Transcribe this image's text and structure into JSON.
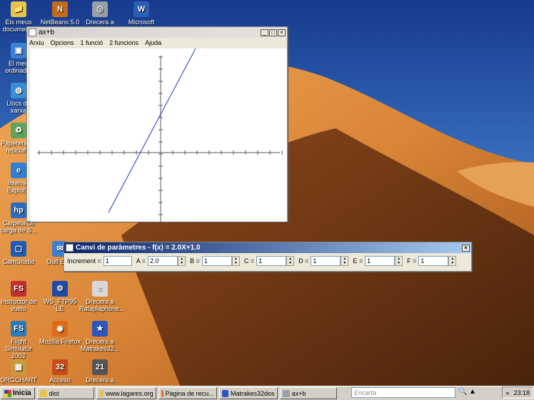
{
  "desktop_icons": [
    {
      "label": "Els meus documen...",
      "color": "#e7c44a",
      "glyph": "📁"
    },
    {
      "label": "NetBeans 5.0",
      "color": "#c46b1a",
      "glyph": "N"
    },
    {
      "label": "Drecera a",
      "color": "#9aa0aa",
      "glyph": "◎"
    },
    {
      "label": "Microsoft Word",
      "color": "#2b5fb5",
      "glyph": "W"
    },
    {
      "label": "El meu ordinad...",
      "color": "#3b7fd6",
      "glyph": "▣"
    },
    {
      "label": "Llocs de xarxa",
      "color": "#3a8ed4",
      "glyph": "◍"
    },
    {
      "label": "Paperera de reciclat...",
      "color": "#5ea35e",
      "glyph": "♻"
    },
    {
      "label": "Internet Explor...",
      "color": "#2f7fd2",
      "glyph": "e"
    },
    {
      "label": "Carpeta de carga de S...",
      "color": "#2b6bc0",
      "glyph": "hp"
    },
    {
      "label": "CamStudio",
      "color": "#1d5cb8",
      "glyph": "▢"
    },
    {
      "label": "Outl Expr",
      "color": "#3a7fd0",
      "glyph": "✉"
    },
    {
      "label": "Instructor de vuelo",
      "color": "#c03030",
      "glyph": "FS"
    },
    {
      "label": "WS_FTP95 LE",
      "color": "#1f4aa8",
      "glyph": "⚙"
    },
    {
      "label": "Drecera a Rataplaphone...",
      "color": "#d8d8d8",
      "glyph": "☼"
    },
    {
      "label": "Flight Simulator 2002",
      "color": "#2a7ab8",
      "glyph": "FS"
    },
    {
      "label": "Mozilla Firefox",
      "color": "#e06a1a",
      "glyph": "◉"
    },
    {
      "label": "Drecera a Matrakes32...",
      "color": "#2b55c0",
      "glyph": "★"
    },
    {
      "label": "ORGCHART ...",
      "color": "#c89a3a",
      "glyph": "▦"
    },
    {
      "label": "Acceso directo",
      "color": "#c84a1a",
      "glyph": "32"
    },
    {
      "label": "Drecera a",
      "color": "#555555",
      "glyph": "21"
    }
  ],
  "graph_window": {
    "title": "ax+b",
    "menu": [
      "Arxiu",
      "Opcions",
      "1 funció",
      "2 funcions",
      "Ajuda"
    ]
  },
  "param_window": {
    "title": "Canvi de paràmetres - f(x) = 2.0X+1.0",
    "fields": [
      {
        "label": "Increment =",
        "value": "1"
      },
      {
        "label": "A =",
        "value": "2.0"
      },
      {
        "label": "B =",
        "value": "1"
      },
      {
        "label": "C =",
        "value": "1"
      },
      {
        "label": "D =",
        "value": "1"
      },
      {
        "label": "E =",
        "value": "1"
      },
      {
        "label": "F =",
        "value": "1"
      }
    ]
  },
  "taskbar": {
    "start": "Inicia",
    "tasks": [
      {
        "label": "dist",
        "color": "#e7c44a"
      },
      {
        "label": "www.lagares.org",
        "color": "#e7c44a"
      },
      {
        "label": "Pàgina de recu...",
        "color": "#e06a1a"
      },
      {
        "label": "Matrakes32dos",
        "color": "#2b55c0"
      },
      {
        "label": "ax+b",
        "color": "#9aa0aa"
      }
    ],
    "search_placeholder": "Encarta",
    "clock": "23:18"
  },
  "colors": {
    "title_active": "#0a246a",
    "plot_line": "#1f2fd0",
    "axis": "#555555"
  }
}
